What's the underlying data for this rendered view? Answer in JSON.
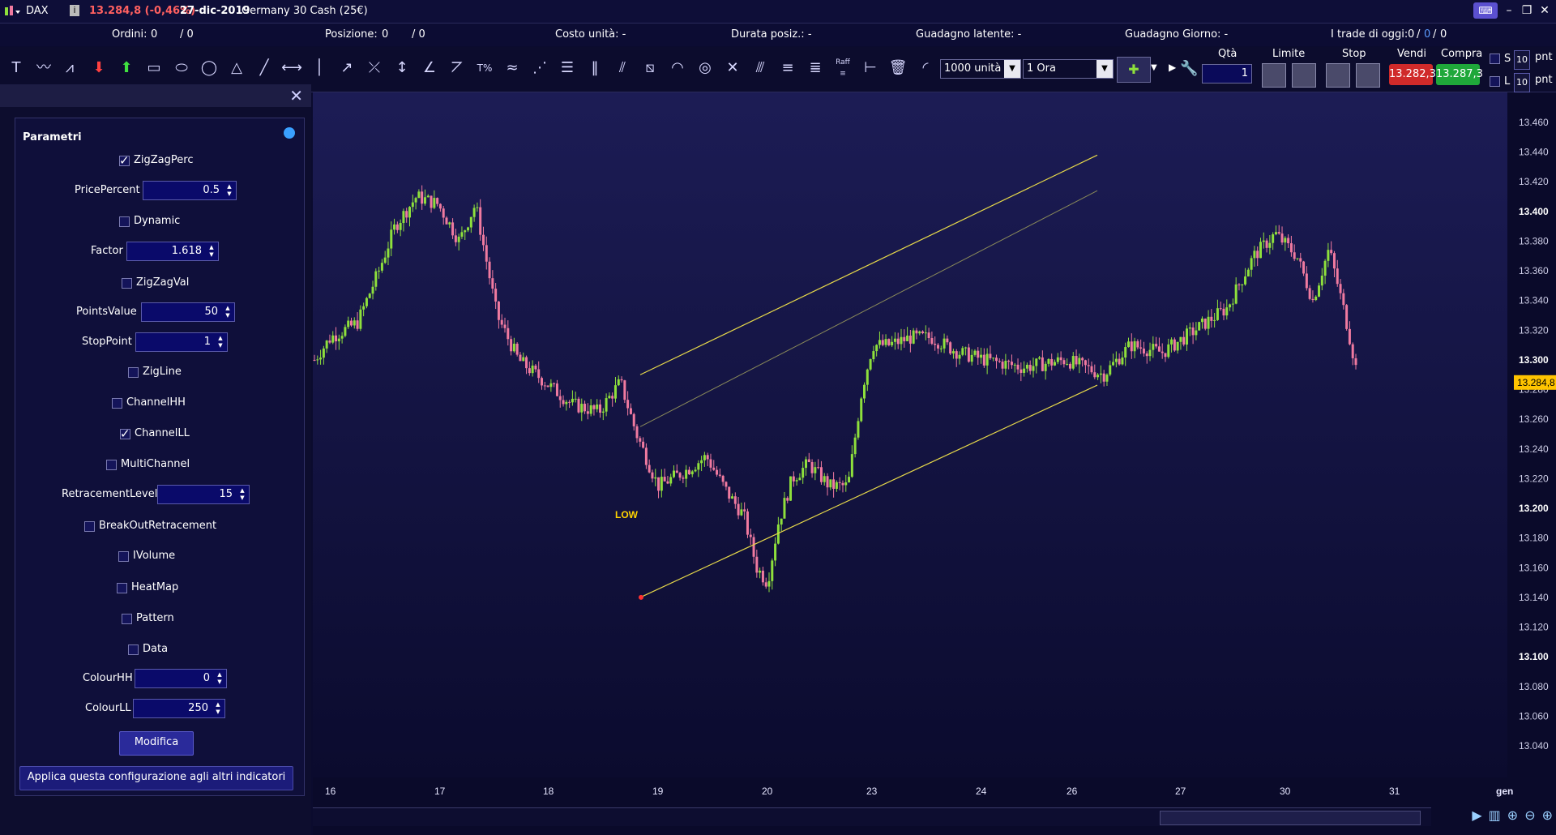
{
  "topbar": {
    "instrument": "DAX",
    "price": "13.284,8 (-0,46%)",
    "date": "27-dic-2019",
    "name": "Germany 30 Cash (25€)"
  },
  "status": {
    "ordini_label": "Ordini:",
    "ordini_val": "0",
    "ordini_val2": "/ 0",
    "posizione_label": "Posizione:",
    "posizione_val": "0",
    "posizione_val2": "/ 0",
    "costo": "Costo unità: -",
    "durata": "Durata posiz.: -",
    "latente": "Guadagno latente: -",
    "giorno": "Guadagno Giorno: -",
    "trade_label": "I trade di oggi:",
    "trade_a": "0",
    "trade_b": "0",
    "trade_c": "0"
  },
  "toolbar": {
    "units": "1000 unità",
    "timeframe": "1 Ora",
    "qta_label": "Qtà",
    "qta_value": "1",
    "limite_label": "Limite",
    "stop_label": "Stop",
    "vendi_label": "Vendi",
    "compra_label": "Compra",
    "vendi_price": "13.282,3",
    "compra_price": "13.287,3",
    "s_label": "S",
    "l_label": "L",
    "pnt_value": "10",
    "pnt_label": "pnt",
    "raff_label": "Raff"
  },
  "panel": {
    "title": "Parametri",
    "rows": [
      {
        "label": "ZigZagPerc",
        "type": "check",
        "checked": true
      },
      {
        "label": "PricePercent",
        "type": "num",
        "value": "0.5"
      },
      {
        "label": "Dynamic",
        "type": "check",
        "checked": false
      },
      {
        "label": "Factor",
        "type": "num",
        "value": "1.618"
      },
      {
        "label": "ZigZagVal",
        "type": "check",
        "checked": false
      },
      {
        "label": "PointsValue",
        "type": "num",
        "value": "50"
      },
      {
        "label": "StopPoint",
        "type": "num",
        "value": "1"
      },
      {
        "label": "ZigLine",
        "type": "check",
        "checked": false
      },
      {
        "label": "ChannelHH",
        "type": "check",
        "checked": false
      },
      {
        "label": "ChannelLL",
        "type": "check",
        "checked": true
      },
      {
        "label": "MultiChannel",
        "type": "check",
        "checked": false
      },
      {
        "label": "RetracementLevel",
        "type": "num",
        "value": "15"
      },
      {
        "label": "BreakOutRetracement",
        "type": "check",
        "checked": false
      },
      {
        "label": "IVolume",
        "type": "check",
        "checked": false
      },
      {
        "label": "HeatMap",
        "type": "check",
        "checked": false
      },
      {
        "label": "Pattern",
        "type": "check",
        "checked": false
      },
      {
        "label": "Data",
        "type": "check",
        "checked": false
      },
      {
        "label": "ColourHH",
        "type": "num",
        "value": "0"
      },
      {
        "label": "ColourLL",
        "type": "num",
        "value": "250"
      }
    ],
    "modify_button": "Modifica",
    "apply_button": "Applica questa configurazione agli altri indicatori"
  },
  "chart_data": {
    "type": "candlestick",
    "y_ticks": [
      "13.460",
      "13.440",
      "13.420",
      "13.400",
      "13.380",
      "13.360",
      "13.340",
      "13.320",
      "13.300",
      "13.280",
      "13.260",
      "13.240",
      "13.220",
      "13.200",
      "13.180",
      "13.160",
      "13.140",
      "13.120",
      "13.100",
      "13.080",
      "13.060",
      "13.040"
    ],
    "y_bold": [
      "13.400",
      "13.300",
      "13.200",
      "13.100"
    ],
    "ylim": [
      13030,
      13470
    ],
    "x_labels": [
      "16",
      "17",
      "18",
      "19",
      "20",
      "23",
      "24",
      "26",
      "27",
      "30",
      "31",
      "gen"
    ],
    "current_price_label": "13.284,8",
    "annotation": "LOW",
    "colors": {
      "up": "#8ee03c",
      "down": "#f07aa0",
      "channel": "#e6d84a",
      "background_top": "#1c1c55",
      "background_bottom": "#0b0b2e"
    },
    "channel": {
      "lower_start_value": 13140,
      "lower_end_value": 13283,
      "upper_start_value": 13290,
      "upper_end_value": 13438,
      "mid_start_value": 13255,
      "mid_end_value": 13414
    }
  }
}
